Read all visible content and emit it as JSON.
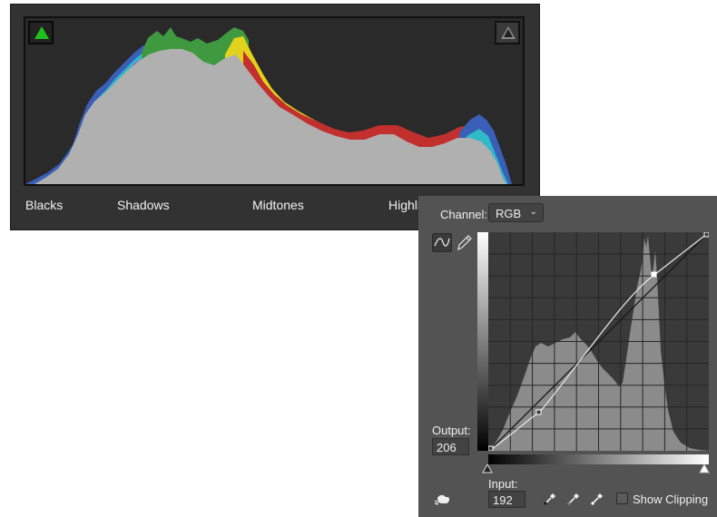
{
  "histogram": {
    "zones": [
      "Blacks",
      "Shadows",
      "Midtones",
      "Highli"
    ],
    "shadow_clip_color": "#1fc11f",
    "highlight_clip_color": "#202020"
  },
  "curves": {
    "channel_label": "Channel:",
    "channel_value": "RGB",
    "output_label": "Output:",
    "output_value": "206",
    "input_label": "Input:",
    "input_value": "192",
    "show_clipping_label": "Show Clipping",
    "show_clipping_checked": false
  },
  "icons": [
    "shadow-clipping-icon",
    "highlight-clipping-icon",
    "curve-edit-icon",
    "pencil-icon",
    "hand-adjust-icon",
    "black-point-eyedropper-icon",
    "gray-point-eyedropper-icon",
    "white-point-eyedropper-icon"
  ]
}
